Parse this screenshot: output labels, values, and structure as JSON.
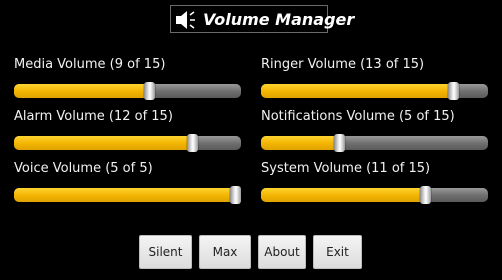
{
  "app": {
    "title": "Volume Manager",
    "icon": "speaker-icon"
  },
  "volumes": {
    "media": {
      "label": "Media Volume (9 of 15)",
      "value": 9,
      "max": 15
    },
    "ringer": {
      "label": "Ringer Volume (13 of 15)",
      "value": 13,
      "max": 15
    },
    "alarm": {
      "label": "Alarm Volume (12 of 15)",
      "value": 12,
      "max": 15
    },
    "notifications": {
      "label": "Notifications Volume (5 of 15)",
      "value": 5,
      "max": 15
    },
    "voice": {
      "label": "Voice Volume (5 of 5)",
      "value": 5,
      "max": 5
    },
    "system": {
      "label": "System Volume (11 of 15)",
      "value": 11,
      "max": 15
    }
  },
  "buttons": {
    "silent": "Silent",
    "max": "Max",
    "about": "About",
    "exit": "Exit"
  },
  "colors": {
    "background": "#000000",
    "slider_fill": "#f2b400",
    "slider_track": "#6e6e6e",
    "button_bg": "#e8e8e8"
  }
}
